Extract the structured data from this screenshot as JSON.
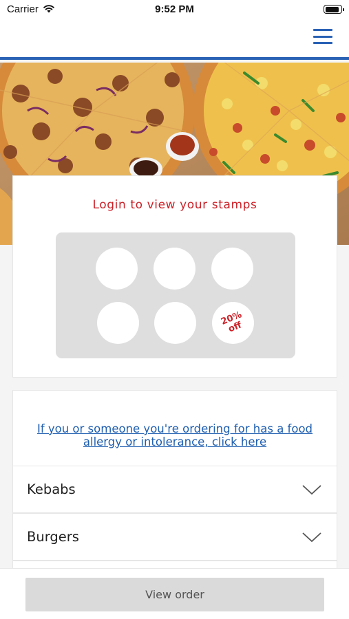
{
  "status_bar": {
    "carrier": "Carrier",
    "time": "9:52 PM",
    "battery_level": 0.9,
    "icons": [
      "wifi-icon",
      "battery-icon"
    ]
  },
  "nav": {
    "menu_icon": "hamburger-menu-icon",
    "accent_color": "#2a62b5"
  },
  "hero": {
    "image": "pizza-photo"
  },
  "stamp_card": {
    "title": "Login to view your stamps",
    "stamp_count": 6,
    "reward_text": "20% off",
    "title_color": "#cc2128"
  },
  "allergy": {
    "link_text": "If you or someone you're ordering for has a food allergy or intolerance, click here"
  },
  "categories": [
    {
      "label": "Kebabs",
      "icon": "chevron-down-icon"
    },
    {
      "label": "Burgers",
      "icon": "chevron-down-icon"
    }
  ],
  "footer": {
    "view_order_label": "View order"
  }
}
